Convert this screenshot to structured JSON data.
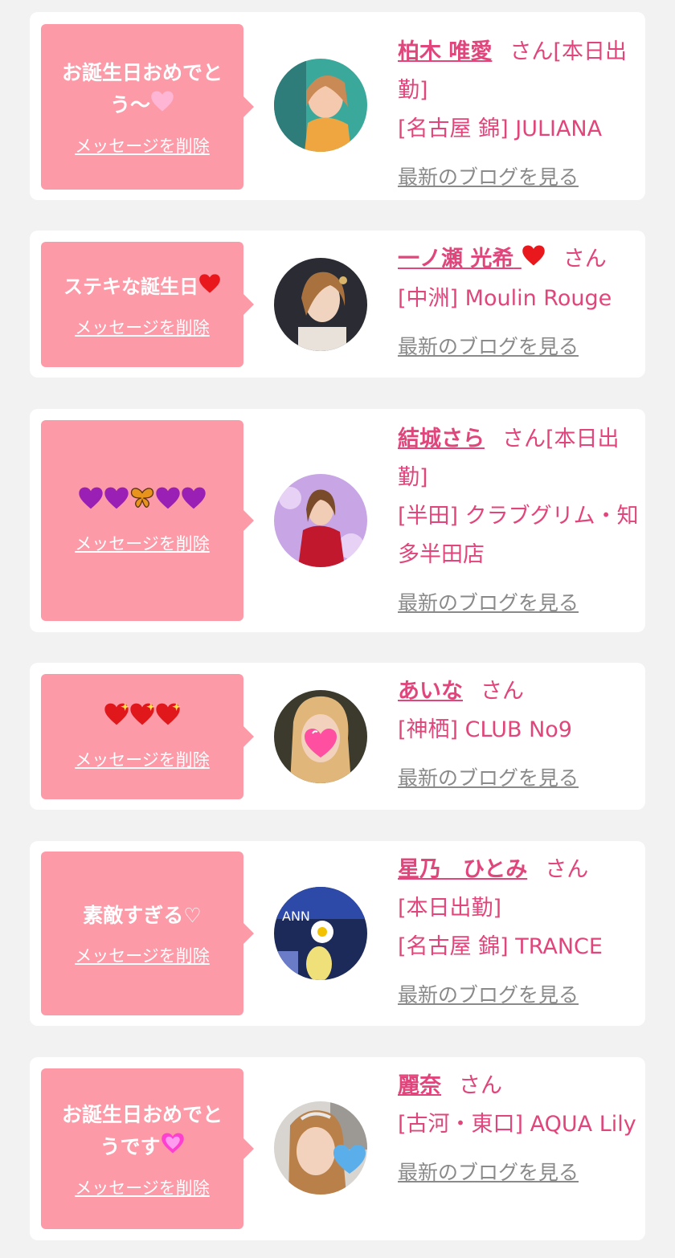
{
  "common": {
    "delete_label": "メッセージを削除",
    "blog_label": "最新のブログを見る",
    "suffix": "さん"
  },
  "colors": {
    "background": "#f2f2f2",
    "bubble": "#fd9aa8",
    "accent": "#e0457b",
    "link_gray": "#8a8a8a"
  },
  "cards": [
    {
      "message": "お誕生日おめでとう〜",
      "message_icon": "pink-heart-icon",
      "name": "柏木 唯愛",
      "status": "[本日出勤]",
      "shop": "[名古屋 錦] JULIANA"
    },
    {
      "message": "ステキな誕生日",
      "message_icon": "red-heart-icon",
      "name": "一ノ瀬 光希",
      "name_icon": "red-heart-icon",
      "status": "",
      "shop": "[中洲] Moulin Rouge"
    },
    {
      "message": "",
      "message_icons": [
        "purple-heart-icon",
        "purple-heart-icon",
        "butterfly-icon",
        "purple-heart-icon",
        "purple-heart-icon"
      ],
      "name": "結城さら",
      "status": "[本日出勤]",
      "shop": "[半田] クラブグリム・知多半田店"
    },
    {
      "message": "",
      "message_icons": [
        "sparkling-heart-icon",
        "sparkling-heart-icon",
        "sparkling-heart-icon"
      ],
      "name": "あいな",
      "status": "",
      "shop": "[神栖] CLUB No9"
    },
    {
      "message": "素敵すぎる♡",
      "name": "星乃　ひとみ",
      "status": "[本日出勤]",
      "shop": "[名古屋 錦] TRANCE"
    },
    {
      "message": "お誕生日おめでとうです",
      "message_icon": "sparkling-heart-icon",
      "name": "麗奈",
      "status": "",
      "shop": "[古河・東口] AQUA Lily"
    }
  ]
}
